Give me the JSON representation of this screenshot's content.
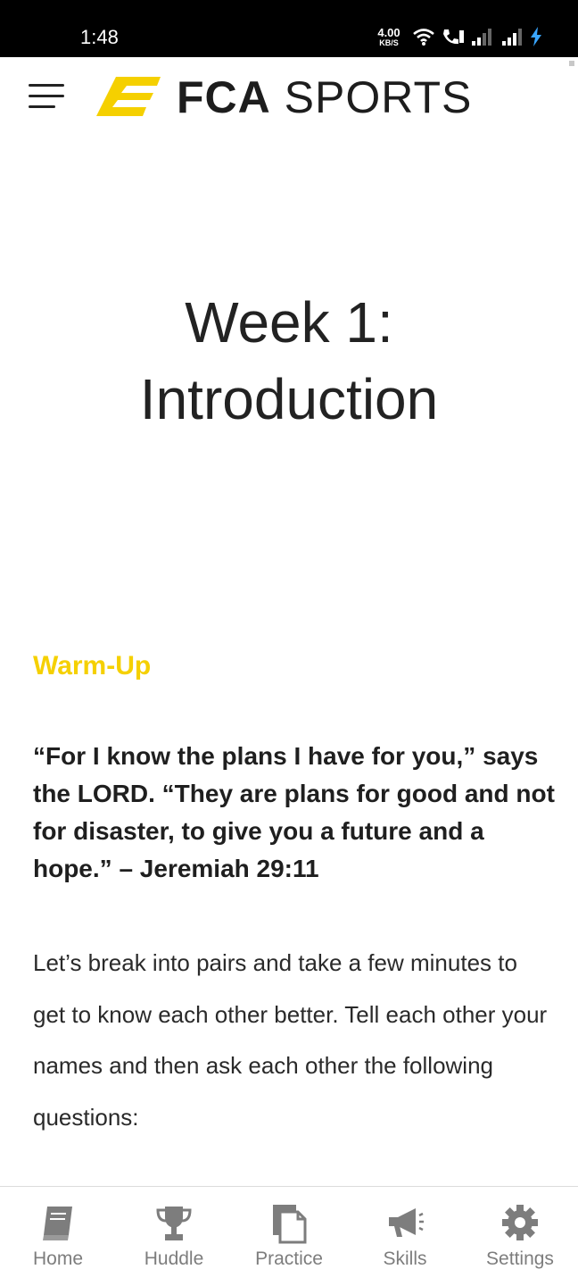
{
  "status_bar": {
    "time": "1:48",
    "net_speed_value": "4.00",
    "net_speed_unit": "KB/S",
    "icons": [
      "wifi-icon",
      "call-icon",
      "signal-icon",
      "signal-icon",
      "charging-icon"
    ]
  },
  "header": {
    "menu_icon": "hamburger-menu-icon",
    "brand_bold": "FCA",
    "brand_light": "SPORTS",
    "accent_color": "#f5d000"
  },
  "content": {
    "title_line1": "Week 1:",
    "title_line2": "Introduction",
    "section_heading": "Warm-Up",
    "verse": "“For I know the plans I have for you,” says the LORD. “They are plans for good and not for disaster, to give you a future and a hope.” – Jeremiah 29:11",
    "body": "Let’s break into pairs and take a few minutes to get to know each other better. Tell each other your names and then ask each other the following questions:"
  },
  "bottom_nav": {
    "items": [
      {
        "label": "Home",
        "icon": "book-icon"
      },
      {
        "label": "Huddle",
        "icon": "trophy-icon"
      },
      {
        "label": "Practice",
        "icon": "documents-icon"
      },
      {
        "label": "Skills",
        "icon": "megaphone-icon"
      },
      {
        "label": "Settings",
        "icon": "gear-icon"
      }
    ],
    "icon_color": "#7d7d7d"
  }
}
